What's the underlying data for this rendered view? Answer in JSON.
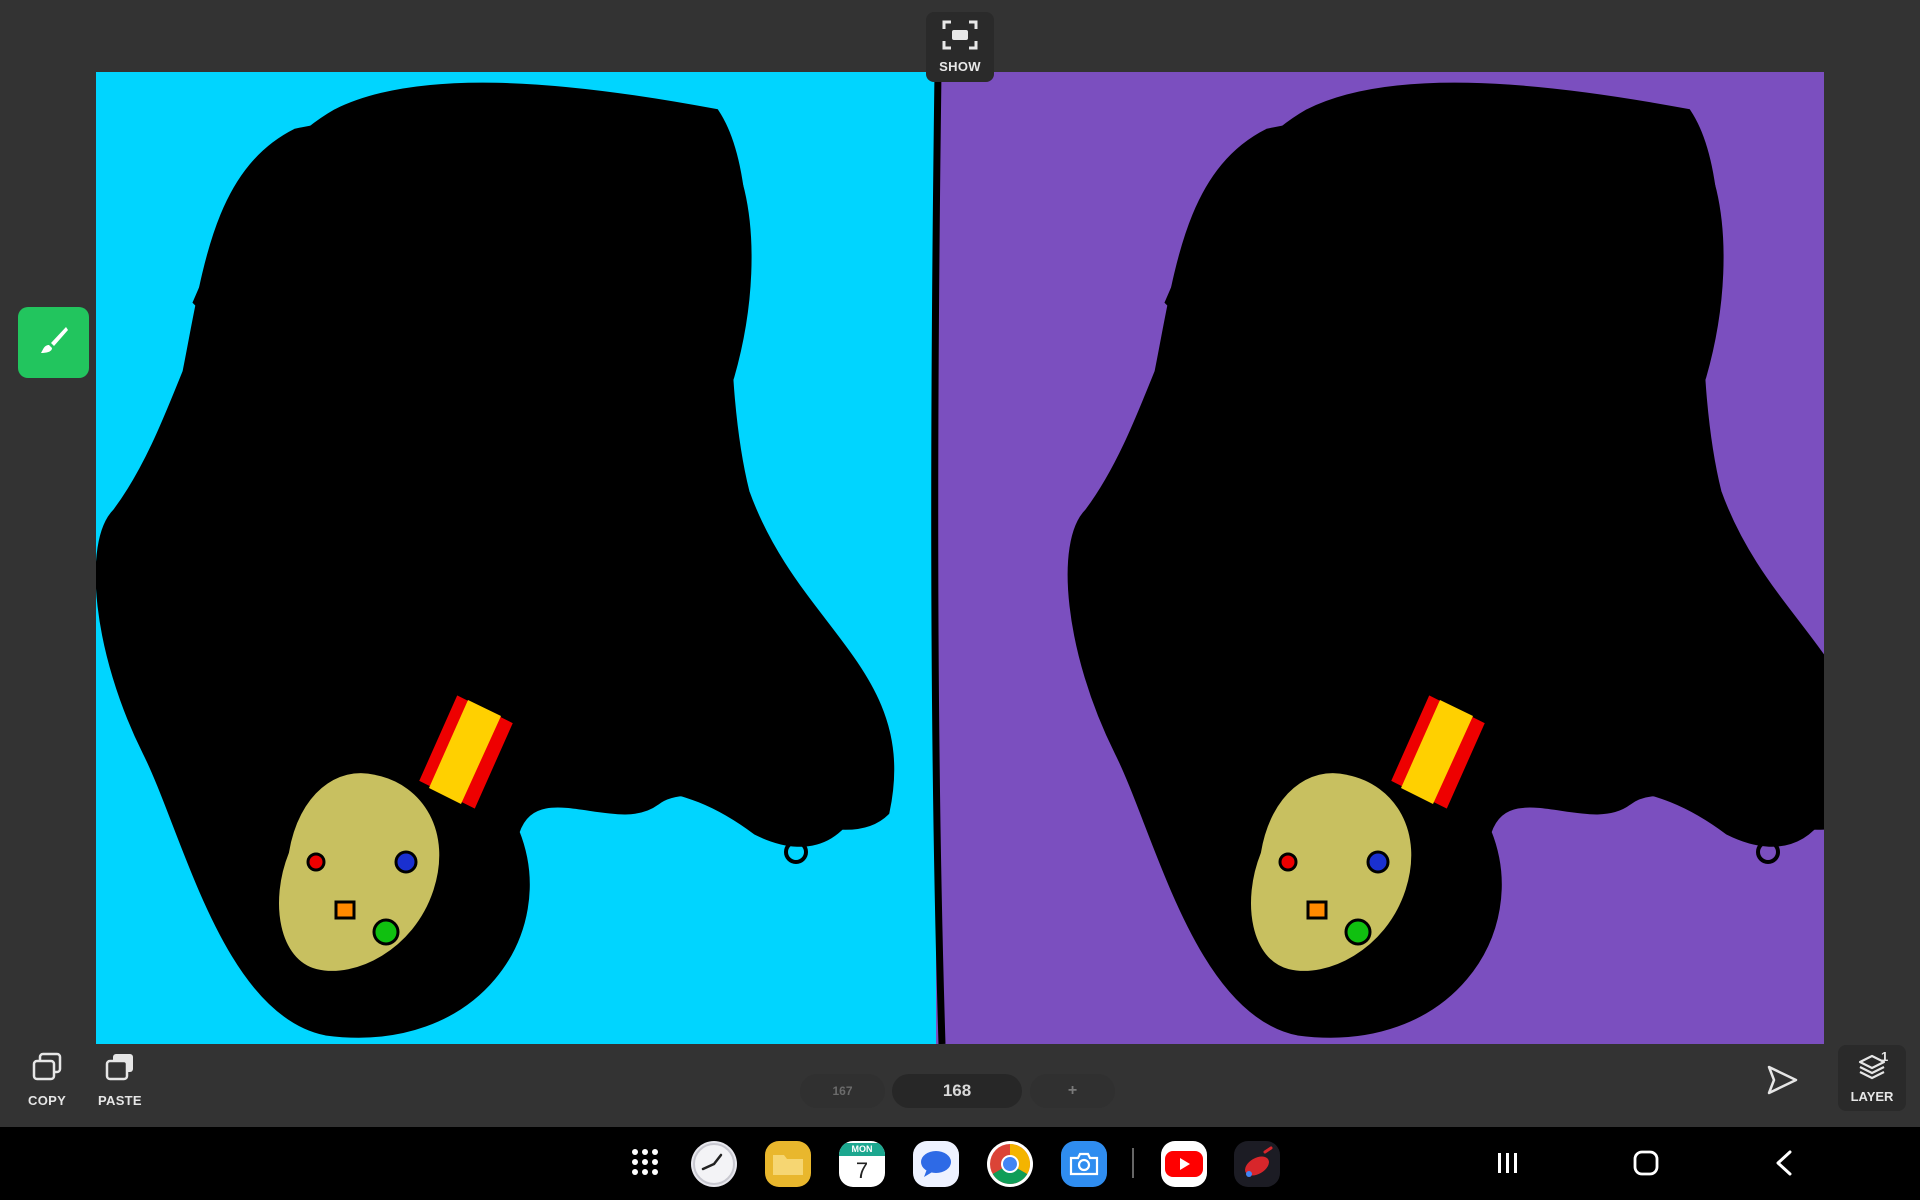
{
  "top": {
    "show_label": "SHOW"
  },
  "tools": {
    "copy_label": "COPY",
    "paste_label": "PASTE"
  },
  "frames": {
    "previous": "167",
    "current": "168",
    "add": "+"
  },
  "layer": {
    "label": "LAYER",
    "count": "1"
  },
  "canvas": {
    "left_background": "#00d5ff",
    "right_background": "#7b4fbf",
    "left_palette": {
      "body": "#10e812",
      "head": "#8b5000",
      "veins": "#666666",
      "strands": "#ffff88",
      "claw": "#ffff00"
    },
    "right_palette": {
      "body": "#047a04",
      "head": "#6a3a00",
      "veins": "#666666",
      "strands": "#d8c260",
      "claw": "#d8c860"
    }
  },
  "icons": {
    "show": "fullscreen-icon",
    "brush": "brush-icon",
    "copy": "copy-icon",
    "paste": "paste-icon",
    "play": "play-icon",
    "layer": "layers-icon"
  },
  "calendar": {
    "weekday": "MON",
    "day": "7"
  },
  "dock": [
    "apps-grid",
    "clock",
    "my-files",
    "calendar",
    "messages",
    "chrome",
    "camera",
    "youtube",
    "paint-app"
  ]
}
